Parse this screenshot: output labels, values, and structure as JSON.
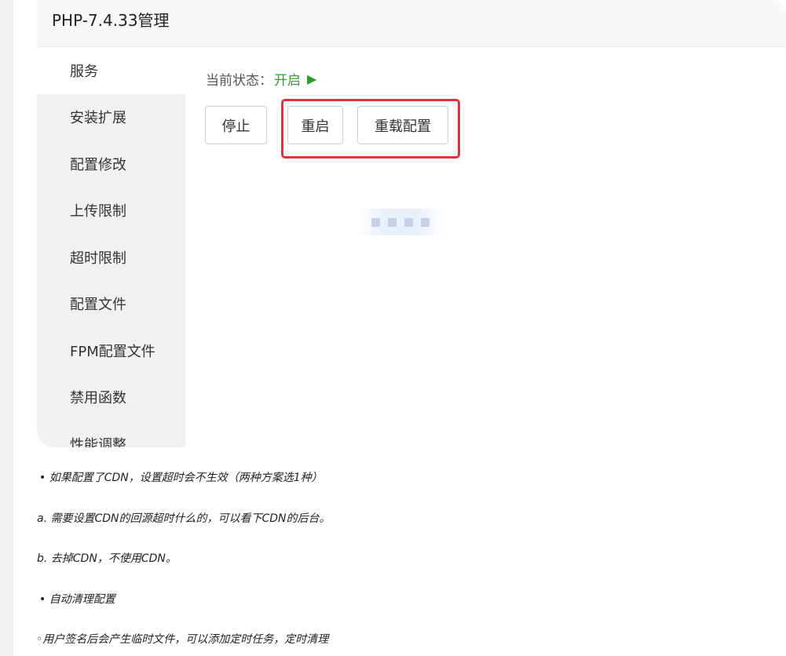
{
  "panel": {
    "title": "PHP-7.4.33管理"
  },
  "sidebar": {
    "items": [
      {
        "label": "服务"
      },
      {
        "label": "安装扩展"
      },
      {
        "label": "配置修改"
      },
      {
        "label": "上传限制"
      },
      {
        "label": "超时限制"
      },
      {
        "label": "配置文件"
      },
      {
        "label": "FPM配置文件"
      },
      {
        "label": "禁用函数"
      },
      {
        "label": "性能调整"
      }
    ],
    "active_index": 0
  },
  "service": {
    "status_label": "当前状态：",
    "status_value": "开启",
    "status_color": "#3c9a3c",
    "buttons": {
      "stop": "停止",
      "restart": "重启",
      "reload": "重载配置"
    }
  },
  "notes": {
    "line1": "• 如果配置了CDN，设置超时会不生效（两种方案选1种）",
    "line2": "a. 需要设置CDN的回源超时什么的，可以看下CDN的后台。",
    "line3": "b. 去掉CDN，不使用CDN。",
    "line4": "• 自动清理配置",
    "line5": "◦用户签名后会产生临时文件，可以添加定时任务，定时清理"
  },
  "colors": {
    "highlight": "#d9363e",
    "status_on": "#3c9a3c"
  }
}
